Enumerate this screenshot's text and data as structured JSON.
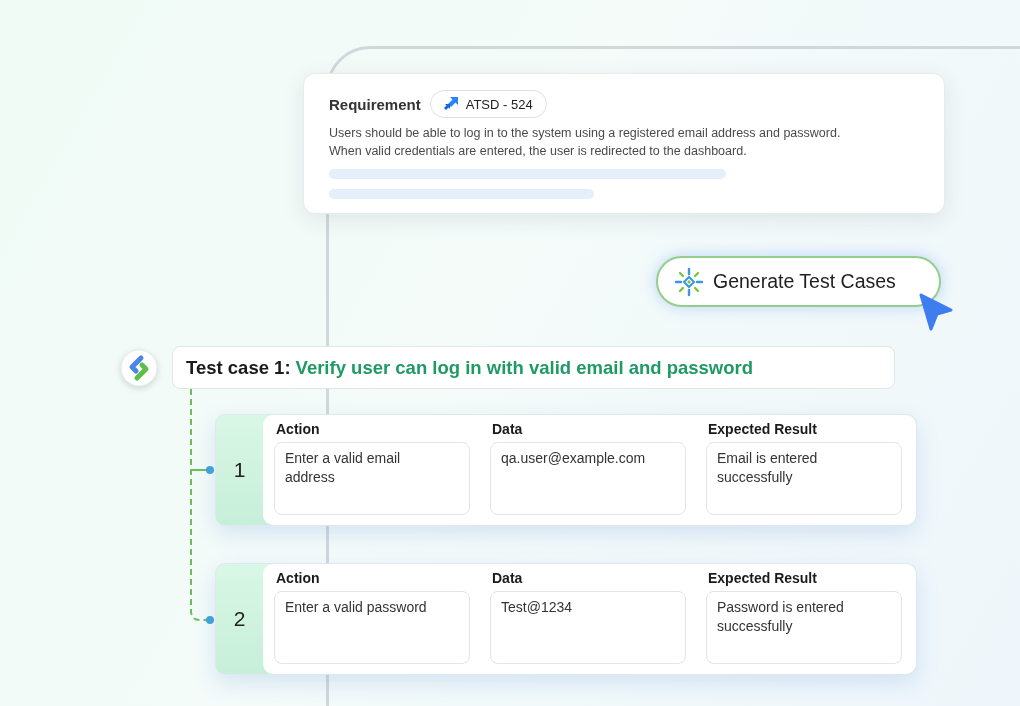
{
  "requirement": {
    "label": "Requirement",
    "ticket": "ATSD - 524",
    "description_lines": [
      "Users should be able to log in to the system using a registered email address and password.",
      "When valid credentials are entered, the user is redirected to the dashboard."
    ]
  },
  "generate_button": {
    "label": "Generate Test Cases"
  },
  "test_case": {
    "label": "Test case 1:",
    "title": "Verify user can log in with valid email and password",
    "steps": [
      {
        "number": "1",
        "fields": [
          {
            "label": "Action",
            "value": "Enter a valid email address"
          },
          {
            "label": "Data",
            "value": "qa.user@example.com"
          },
          {
            "label": "Expected Result",
            "value": "Email is entered successfully"
          }
        ]
      },
      {
        "number": "2",
        "fields": [
          {
            "label": "Action",
            "value": "Enter a valid password"
          },
          {
            "label": "Data",
            "value": "Test@1234"
          },
          {
            "label": "Expected Result",
            "value": "Password is entered successfully"
          }
        ]
      }
    ]
  }
}
